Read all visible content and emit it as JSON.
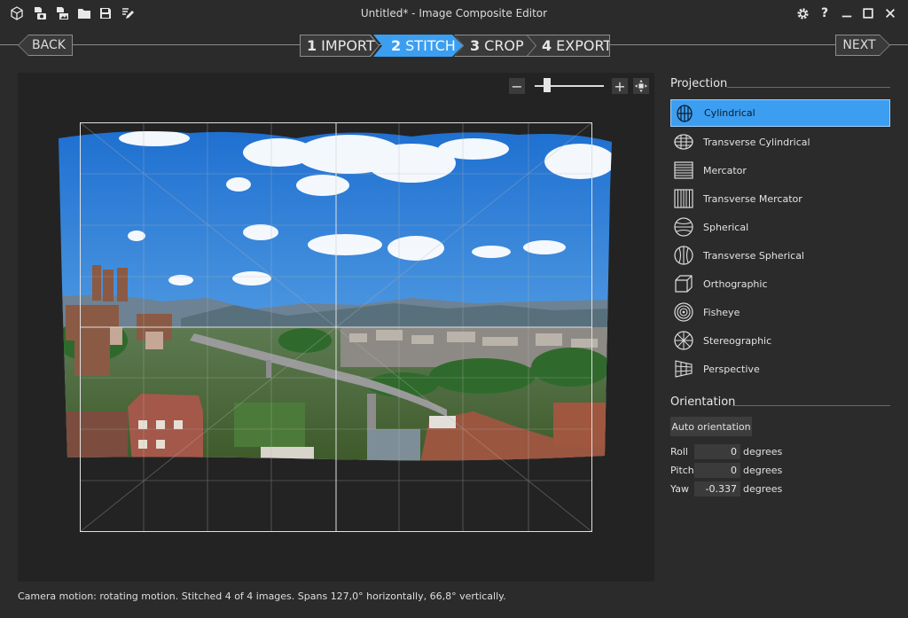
{
  "window": {
    "title": "Untitled* - Image Composite Editor"
  },
  "toolbar": {
    "icons": [
      "cube-icon",
      "new-from-camera-icon",
      "new-from-images-icon",
      "open-folder-icon",
      "save-icon",
      "export-edit-icon"
    ]
  },
  "window_controls": [
    "gear-icon",
    "help-icon",
    "minimize-icon",
    "maximize-icon",
    "close-icon"
  ],
  "help_label": "?",
  "wizard": {
    "back_label": "BACK",
    "next_label": "NEXT",
    "steps": [
      {
        "num": "1",
        "label": "IMPORT",
        "active": false
      },
      {
        "num": "2",
        "label": "STITCH",
        "active": true
      },
      {
        "num": "3",
        "label": "CROP",
        "active": false
      },
      {
        "num": "4",
        "label": "EXPORT",
        "active": false
      }
    ]
  },
  "zoom": {
    "minus_label": "−",
    "plus_label": "+",
    "level": 0.14
  },
  "projection": {
    "title": "Projection",
    "items": [
      {
        "label": "Cylindrical",
        "icon": "cylindrical-icon",
        "selected": true
      },
      {
        "label": "Transverse Cylindrical",
        "icon": "transverse-cylindrical-icon",
        "selected": false
      },
      {
        "label": "Mercator",
        "icon": "mercator-icon",
        "selected": false
      },
      {
        "label": "Transverse Mercator",
        "icon": "transverse-mercator-icon",
        "selected": false
      },
      {
        "label": "Spherical",
        "icon": "spherical-icon",
        "selected": false
      },
      {
        "label": "Transverse Spherical",
        "icon": "transverse-spherical-icon",
        "selected": false
      },
      {
        "label": "Orthographic",
        "icon": "orthographic-icon",
        "selected": false
      },
      {
        "label": "Fisheye",
        "icon": "fisheye-icon",
        "selected": false
      },
      {
        "label": "Stereographic",
        "icon": "stereographic-icon",
        "selected": false
      },
      {
        "label": "Perspective",
        "icon": "perspective-icon",
        "selected": false
      }
    ]
  },
  "orientation": {
    "title": "Orientation",
    "auto_label": "Auto orientation",
    "roll_label": "Roll",
    "roll_value": "0",
    "pitch_label": "Pitch",
    "pitch_value": "0",
    "yaw_label": "Yaw",
    "yaw_value": "-0.337",
    "unit": "degrees"
  },
  "status": "Camera motion: rotating motion. Stitched 4 of 4 images. Spans 127,0° horizontally, 66,8° vertically.",
  "colors": {
    "accent": "#3c9ef0",
    "background": "#2b2b2b",
    "canvas": "#232323"
  }
}
